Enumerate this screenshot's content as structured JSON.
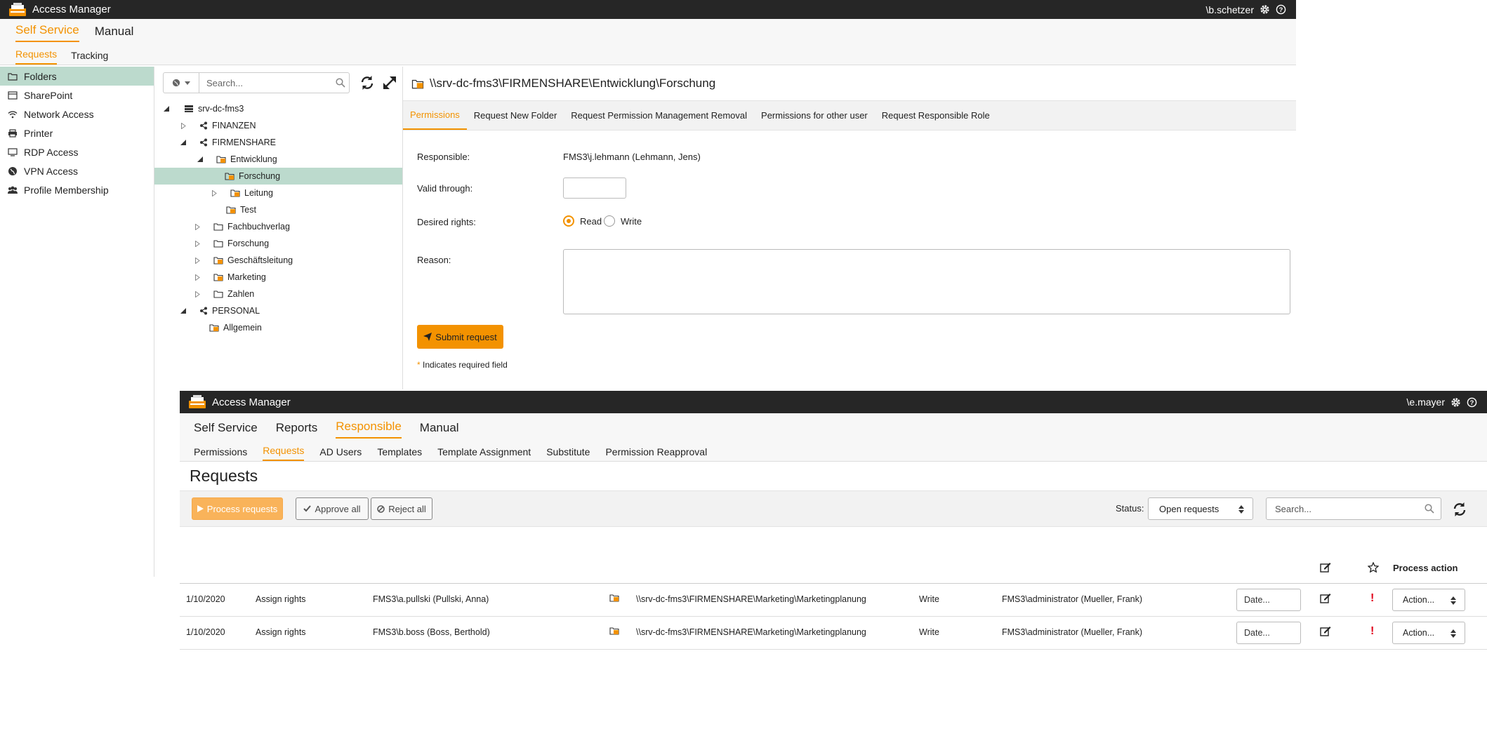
{
  "colors": {
    "accent": "#f39200",
    "titlebar": "#262626",
    "selection": "#bcdacd",
    "alert": "#e0001a"
  },
  "window1": {
    "app_title": "Access Manager",
    "user": "\\b.schetzer",
    "main_nav": [
      "Self Service",
      "Manual"
    ],
    "sub_nav": [
      "Requests",
      "Tracking"
    ],
    "sidebar": [
      {
        "label": "Folders",
        "icon": "folder-icon"
      },
      {
        "label": "SharePoint",
        "icon": "sharepoint-icon"
      },
      {
        "label": "Network Access",
        "icon": "wifi-icon"
      },
      {
        "label": "Printer",
        "icon": "printer-icon"
      },
      {
        "label": "RDP Access",
        "icon": "monitor-icon"
      },
      {
        "label": "VPN Access",
        "icon": "globe-icon"
      },
      {
        "label": "Profile Membership",
        "icon": "users-icon"
      }
    ],
    "tree": {
      "search_placeholder": "Search...",
      "nodes": [
        {
          "label": "srv-dc-fms3",
          "icon": "server-icon"
        },
        {
          "label": "FINANZEN",
          "icon": "share-icon"
        },
        {
          "label": "FIRMENSHARE",
          "icon": "share-icon"
        },
        {
          "label": "Entwicklung",
          "icon": "managed-folder-icon"
        },
        {
          "label": "Forschung",
          "icon": "managed-folder-icon"
        },
        {
          "label": "Leitung",
          "icon": "managed-folder-icon"
        },
        {
          "label": "Test",
          "icon": "managed-folder-icon"
        },
        {
          "label": "Fachbuchverlag",
          "icon": "folder-icon"
        },
        {
          "label": "Forschung",
          "icon": "folder-icon"
        },
        {
          "label": "Geschäftsleitung",
          "icon": "managed-folder-icon"
        },
        {
          "label": "Marketing",
          "icon": "managed-folder-icon"
        },
        {
          "label": "Zahlen",
          "icon": "folder-icon"
        },
        {
          "label": "PERSONAL",
          "icon": "share-icon"
        },
        {
          "label": "Allgemein",
          "icon": "managed-folder-icon"
        }
      ]
    },
    "detail": {
      "path": "\\\\srv-dc-fms3\\FIRMENSHARE\\Entwicklung\\Forschung",
      "tabs": [
        "Permissions",
        "Request New Folder",
        "Request Permission Management Removal",
        "Permissions for other user",
        "Request Responsible Role"
      ],
      "responsible_label": "Responsible:",
      "responsible_value": "FMS3\\j.lehmann (Lehmann, Jens)",
      "valid_label": "Valid through:",
      "rights_label": "Desired rights:",
      "rights_options": [
        "Read",
        "Write"
      ],
      "rights_selected": "Read",
      "reason_label": "Reason:",
      "submit_label": "Submit request",
      "required_note": "Indicates required field",
      "required_star": "*"
    }
  },
  "window2": {
    "app_title": "Access Manager",
    "user": "\\e.mayer",
    "main_nav": [
      "Self Service",
      "Reports",
      "Responsible",
      "Manual"
    ],
    "sub_nav": [
      "Permissions",
      "Requests",
      "AD Users",
      "Templates",
      "Template Assignment",
      "Substitute",
      "Permission Reapproval"
    ],
    "page_title": "Requests",
    "toolbar": {
      "process_label": "Process requests",
      "approve_label": "Approve all",
      "reject_label": "Reject all",
      "status_label": "Status:",
      "status_value": "Open requests",
      "search_placeholder": "Search..."
    },
    "table": {
      "process_action_header": "Process action",
      "rows": [
        {
          "date": "1/10/2020",
          "type": "Assign rights",
          "user": "FMS3\\a.pullski (Pullski, Anna)",
          "path": "\\\\srv-dc-fms3\\FIRMENSHARE\\Marketing\\Marketingplanung",
          "right": "Write",
          "requester": "FMS3\\administrator (Mueller, Frank)",
          "date_placeholder": "Date...",
          "action": "Action...",
          "alert": "!"
        },
        {
          "date": "1/10/2020",
          "type": "Assign rights",
          "user": "FMS3\\b.boss (Boss, Berthold)",
          "path": "\\\\srv-dc-fms3\\FIRMENSHARE\\Marketing\\Marketingplanung",
          "right": "Write",
          "requester": "FMS3\\administrator (Mueller, Frank)",
          "date_placeholder": "Date...",
          "action": "Action...",
          "alert": "!"
        }
      ]
    }
  }
}
